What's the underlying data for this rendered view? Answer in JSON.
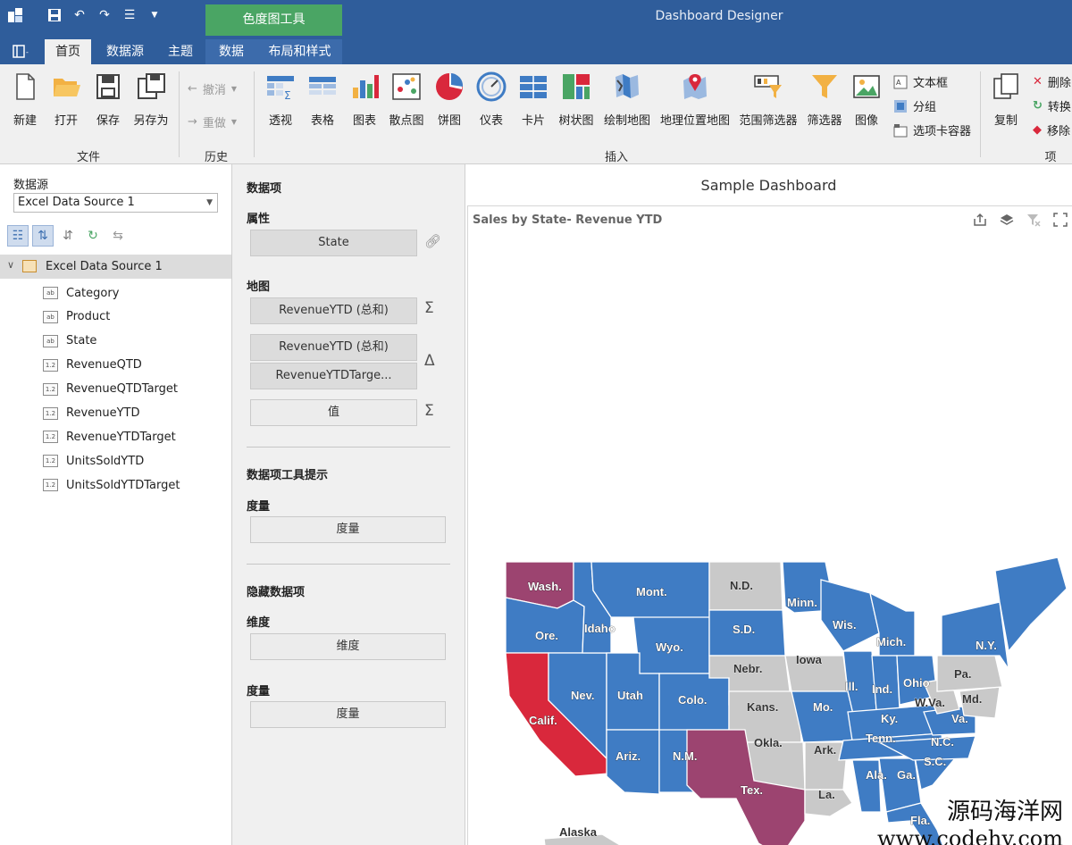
{
  "window": {
    "title": "Dashboard Designer",
    "context_tab_group": "色度图工具"
  },
  "qat": {
    "icons": [
      "app-icon",
      "save-icon",
      "undo-icon",
      "redo-icon",
      "customize-icon",
      "dropdown-icon"
    ]
  },
  "tabs": [
    {
      "label": "首页",
      "active": true
    },
    {
      "label": "数据源",
      "active": false
    },
    {
      "label": "主题",
      "active": false
    },
    {
      "label": "数据",
      "active": false,
      "contextual": true
    },
    {
      "label": "布局和样式",
      "active": false,
      "contextual": true
    }
  ],
  "ribbon": {
    "groups": {
      "file": "文件",
      "history": "历史",
      "insert": "插入",
      "item": "项"
    },
    "file_buttons": [
      "新建",
      "打开",
      "保存",
      "另存为"
    ],
    "history_buttons": [
      "撤消",
      "重做"
    ],
    "insert_buttons": [
      "透视",
      "表格",
      "图表",
      "散点图",
      "饼图",
      "仪表",
      "卡片",
      "树状图",
      "绘制地图",
      "地理位置地图",
      "范围筛选器",
      "筛选器",
      "图像"
    ],
    "insert_small": [
      "文本框",
      "分组",
      "选项卡容器"
    ],
    "item_buttons": [
      "复制"
    ],
    "item_small": [
      "删除",
      "转换",
      "移除"
    ]
  },
  "datasource_panel": {
    "title": "数据源",
    "selected_source": "Excel Data Source 1",
    "root": "Excel Data Source 1",
    "fields": [
      {
        "name": "Category",
        "type": "ab"
      },
      {
        "name": "Product",
        "type": "ab"
      },
      {
        "name": "State",
        "type": "ab"
      },
      {
        "name": "RevenueQTD",
        "type": "1.2"
      },
      {
        "name": "RevenueQTDTarget",
        "type": "1.2"
      },
      {
        "name": "RevenueYTD",
        "type": "1.2"
      },
      {
        "name": "RevenueYTDTarget",
        "type": "1.2"
      },
      {
        "name": "UnitsSoldYTD",
        "type": "1.2"
      },
      {
        "name": "UnitsSoldYTDTarget",
        "type": "1.2"
      }
    ]
  },
  "data_items": {
    "title": "数据项",
    "attribute_label": "属性",
    "attribute_value": "State",
    "map_label": "地图",
    "map_items": [
      "RevenueYTD (总和)",
      "RevenueYTD (总和)",
      "RevenueYTDTarge...",
      "值"
    ],
    "tooltip_title": "数据项工具提示",
    "tooltip_measure_label": "度量",
    "tooltip_measure_value": "度量",
    "hidden_title": "隐藏数据项",
    "hidden_dimension_label": "维度",
    "hidden_dimension_value": "维度",
    "hidden_measure_label": "度量",
    "hidden_measure_value": "度量",
    "sigma": "Σ",
    "delta": "Δ"
  },
  "dashboard": {
    "title": "Sample Dashboard",
    "item_caption": "Sales by State- Revenue YTD",
    "caption_icons": [
      "export-icon",
      "layers-icon",
      "clear-filter-icon",
      "maximize-icon"
    ],
    "colors": {
      "blue": "#3f7cc4",
      "gray": "#c9c9c9",
      "purple": "#9c4470",
      "red": "#d9283c"
    },
    "state_labels": [
      "Wash.",
      "Ore.",
      "Calif.",
      "Nev.",
      "Idaho",
      "Mont.",
      "Wyo.",
      "Utah",
      "Colo.",
      "Ariz.",
      "N.M.",
      "N.D.",
      "S.D.",
      "Nebr.",
      "Kans.",
      "Okla.",
      "Tex.",
      "Minn.",
      "Iowa",
      "Mo.",
      "Ark.",
      "La.",
      "Wis.",
      "Ill.",
      "Mich.",
      "Ind.",
      "Ohio",
      "Ky.",
      "Tenn.",
      "Ala.",
      "Ga.",
      "Fla.",
      "S.C.",
      "N.C.",
      "Va.",
      "W.Va.",
      "Md.",
      "Pa.",
      "N.Y.",
      "Alaska"
    ]
  },
  "watermark": {
    "line1": "源码海洋网",
    "line2": "www.codehy.com"
  }
}
